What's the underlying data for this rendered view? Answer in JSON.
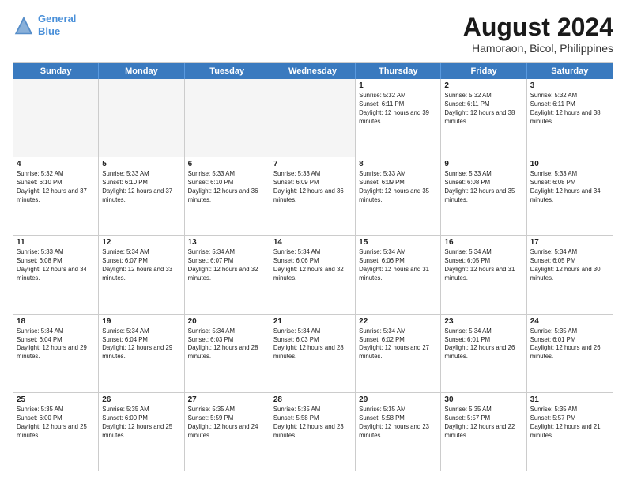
{
  "header": {
    "logo_line1": "General",
    "logo_line2": "Blue",
    "month_title": "August 2024",
    "location": "Hamoraon, Bicol, Philippines"
  },
  "weekdays": [
    "Sunday",
    "Monday",
    "Tuesday",
    "Wednesday",
    "Thursday",
    "Friday",
    "Saturday"
  ],
  "rows": [
    [
      {
        "day": "",
        "empty": true
      },
      {
        "day": "",
        "empty": true
      },
      {
        "day": "",
        "empty": true
      },
      {
        "day": "",
        "empty": true
      },
      {
        "day": "1",
        "sunrise": "5:32 AM",
        "sunset": "6:11 PM",
        "daylight": "12 hours and 39 minutes."
      },
      {
        "day": "2",
        "sunrise": "5:32 AM",
        "sunset": "6:11 PM",
        "daylight": "12 hours and 38 minutes."
      },
      {
        "day": "3",
        "sunrise": "5:32 AM",
        "sunset": "6:11 PM",
        "daylight": "12 hours and 38 minutes."
      }
    ],
    [
      {
        "day": "4",
        "sunrise": "5:32 AM",
        "sunset": "6:10 PM",
        "daylight": "12 hours and 37 minutes."
      },
      {
        "day": "5",
        "sunrise": "5:33 AM",
        "sunset": "6:10 PM",
        "daylight": "12 hours and 37 minutes."
      },
      {
        "day": "6",
        "sunrise": "5:33 AM",
        "sunset": "6:10 PM",
        "daylight": "12 hours and 36 minutes."
      },
      {
        "day": "7",
        "sunrise": "5:33 AM",
        "sunset": "6:09 PM",
        "daylight": "12 hours and 36 minutes."
      },
      {
        "day": "8",
        "sunrise": "5:33 AM",
        "sunset": "6:09 PM",
        "daylight": "12 hours and 35 minutes."
      },
      {
        "day": "9",
        "sunrise": "5:33 AM",
        "sunset": "6:08 PM",
        "daylight": "12 hours and 35 minutes."
      },
      {
        "day": "10",
        "sunrise": "5:33 AM",
        "sunset": "6:08 PM",
        "daylight": "12 hours and 34 minutes."
      }
    ],
    [
      {
        "day": "11",
        "sunrise": "5:33 AM",
        "sunset": "6:08 PM",
        "daylight": "12 hours and 34 minutes."
      },
      {
        "day": "12",
        "sunrise": "5:34 AM",
        "sunset": "6:07 PM",
        "daylight": "12 hours and 33 minutes."
      },
      {
        "day": "13",
        "sunrise": "5:34 AM",
        "sunset": "6:07 PM",
        "daylight": "12 hours and 32 minutes."
      },
      {
        "day": "14",
        "sunrise": "5:34 AM",
        "sunset": "6:06 PM",
        "daylight": "12 hours and 32 minutes."
      },
      {
        "day": "15",
        "sunrise": "5:34 AM",
        "sunset": "6:06 PM",
        "daylight": "12 hours and 31 minutes."
      },
      {
        "day": "16",
        "sunrise": "5:34 AM",
        "sunset": "6:05 PM",
        "daylight": "12 hours and 31 minutes."
      },
      {
        "day": "17",
        "sunrise": "5:34 AM",
        "sunset": "6:05 PM",
        "daylight": "12 hours and 30 minutes."
      }
    ],
    [
      {
        "day": "18",
        "sunrise": "5:34 AM",
        "sunset": "6:04 PM",
        "daylight": "12 hours and 29 minutes."
      },
      {
        "day": "19",
        "sunrise": "5:34 AM",
        "sunset": "6:04 PM",
        "daylight": "12 hours and 29 minutes."
      },
      {
        "day": "20",
        "sunrise": "5:34 AM",
        "sunset": "6:03 PM",
        "daylight": "12 hours and 28 minutes."
      },
      {
        "day": "21",
        "sunrise": "5:34 AM",
        "sunset": "6:03 PM",
        "daylight": "12 hours and 28 minutes."
      },
      {
        "day": "22",
        "sunrise": "5:34 AM",
        "sunset": "6:02 PM",
        "daylight": "12 hours and 27 minutes."
      },
      {
        "day": "23",
        "sunrise": "5:34 AM",
        "sunset": "6:01 PM",
        "daylight": "12 hours and 26 minutes."
      },
      {
        "day": "24",
        "sunrise": "5:35 AM",
        "sunset": "6:01 PM",
        "daylight": "12 hours and 26 minutes."
      }
    ],
    [
      {
        "day": "25",
        "sunrise": "5:35 AM",
        "sunset": "6:00 PM",
        "daylight": "12 hours and 25 minutes."
      },
      {
        "day": "26",
        "sunrise": "5:35 AM",
        "sunset": "6:00 PM",
        "daylight": "12 hours and 25 minutes."
      },
      {
        "day": "27",
        "sunrise": "5:35 AM",
        "sunset": "5:59 PM",
        "daylight": "12 hours and 24 minutes."
      },
      {
        "day": "28",
        "sunrise": "5:35 AM",
        "sunset": "5:58 PM",
        "daylight": "12 hours and 23 minutes."
      },
      {
        "day": "29",
        "sunrise": "5:35 AM",
        "sunset": "5:58 PM",
        "daylight": "12 hours and 23 minutes."
      },
      {
        "day": "30",
        "sunrise": "5:35 AM",
        "sunset": "5:57 PM",
        "daylight": "12 hours and 22 minutes."
      },
      {
        "day": "31",
        "sunrise": "5:35 AM",
        "sunset": "5:57 PM",
        "daylight": "12 hours and 21 minutes."
      }
    ]
  ]
}
